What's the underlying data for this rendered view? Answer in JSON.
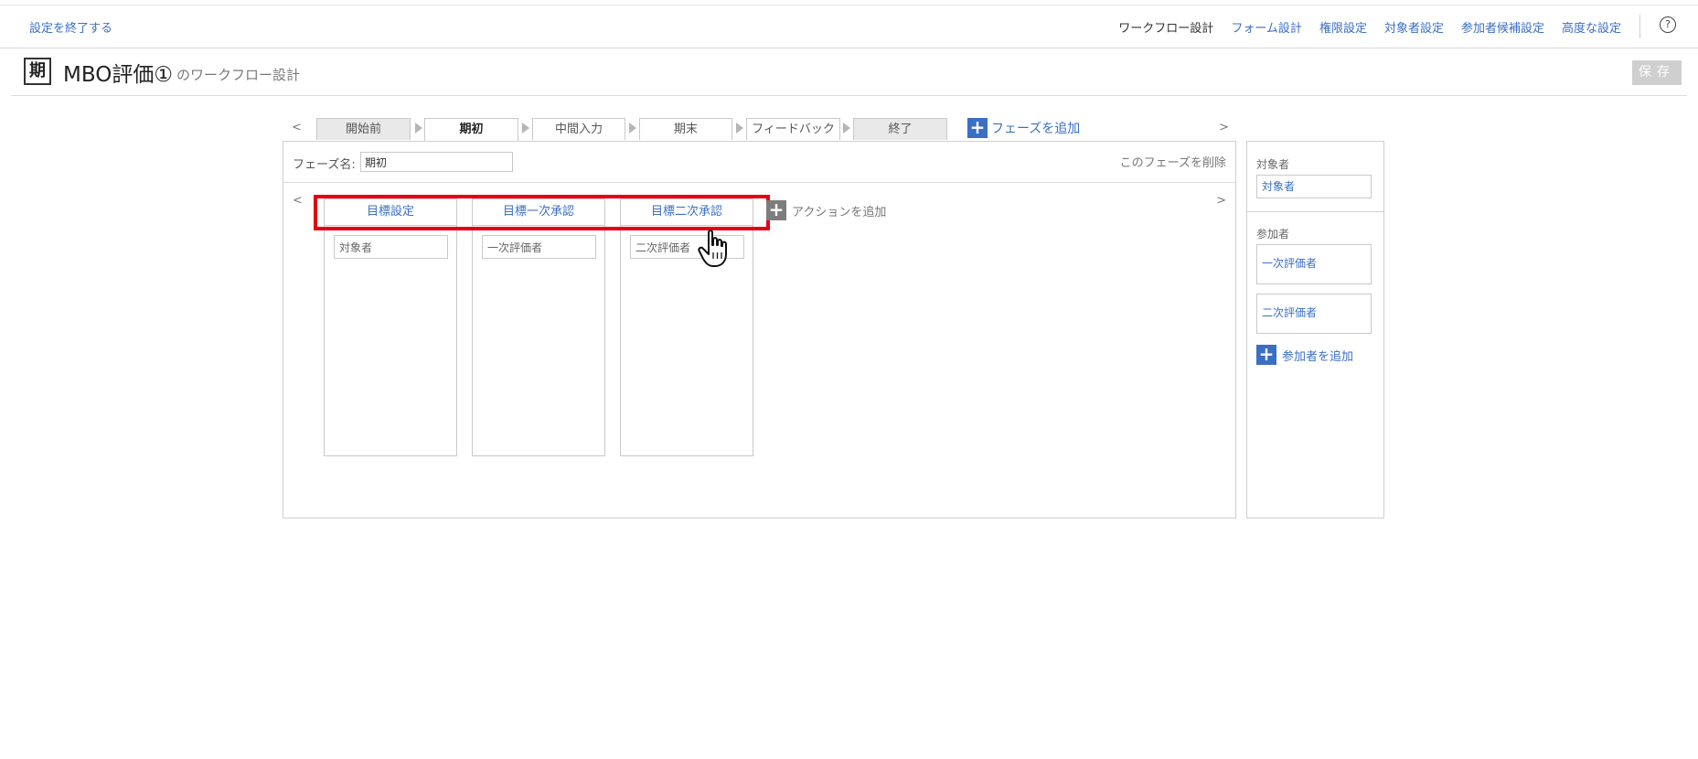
{
  "topbar": {
    "exit_label": "設定を終了する",
    "nav": [
      "ワークフロー設計",
      "フォーム設計",
      "権限設定",
      "対象者設定",
      "参加者候補設定",
      "高度な設定"
    ],
    "help_icon": "question-circle-icon",
    "help_glyph": "?"
  },
  "header": {
    "badge": "期",
    "title": "MBO評価①",
    "subtitle": "のワークフロー設計",
    "save_label": "保存"
  },
  "phases": {
    "prev_arrow": "<",
    "next_arrow": ">",
    "tabs": [
      {
        "label": "開始前",
        "state": "gray"
      },
      {
        "label": "期初",
        "state": "selected"
      },
      {
        "label": "中間入力",
        "state": "plain"
      },
      {
        "label": "期末",
        "state": "plain"
      },
      {
        "label": "フィードバック",
        "state": "plain"
      },
      {
        "label": "終了",
        "state": "gray"
      }
    ],
    "add_label": "フェーズを追加"
  },
  "phase_detail": {
    "name_label": "フェーズ名:",
    "name_value": "期初",
    "delete_label": "このフェーズを削除",
    "prev_arrow": "<",
    "next_arrow": ">",
    "actions": [
      {
        "title": "目標設定",
        "actor": "対象者"
      },
      {
        "title": "目標一次承認",
        "actor": "一次評価者"
      },
      {
        "title": "目標二次承認",
        "actor": "二次評価者"
      }
    ],
    "add_action_label": "アクションを追加"
  },
  "sidebar": {
    "target_title": "対象者",
    "target_value": "対象者",
    "participants_title": "参加者",
    "participants": [
      "一次評価者",
      "二次評価者"
    ],
    "add_participant_label": "参加者を追加"
  },
  "colors": {
    "accent": "#3b6fc4",
    "highlight": "#e60012"
  },
  "plus_glyph": "+"
}
